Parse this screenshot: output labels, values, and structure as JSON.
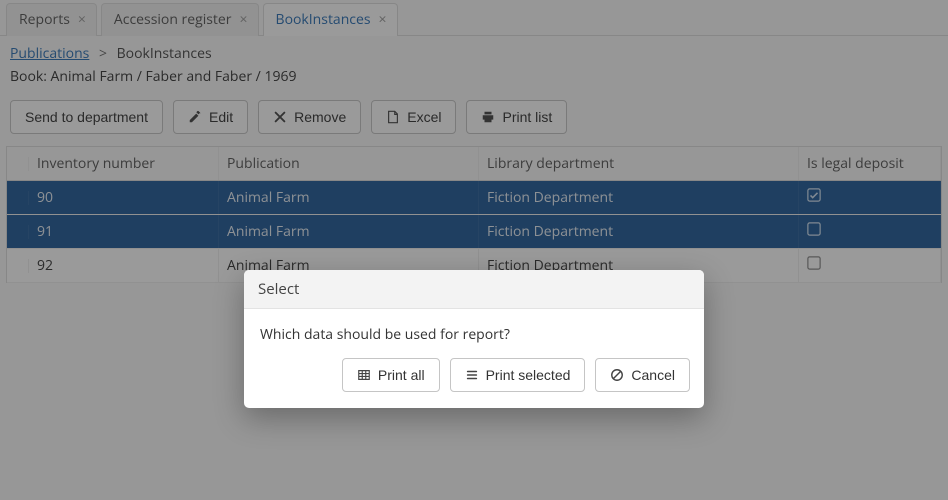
{
  "tabs": [
    {
      "label": "Reports",
      "active": false
    },
    {
      "label": "Accession register",
      "active": false
    },
    {
      "label": "BookInstances",
      "active": true
    }
  ],
  "breadcrumb": {
    "root": "Publications",
    "current": "BookInstances"
  },
  "subtitle": "Book: Animal Farm / Faber and Faber / 1969",
  "toolbar": {
    "send": "Send to department",
    "edit": "Edit",
    "remove": "Remove",
    "excel": "Excel",
    "print": "Print list"
  },
  "columns": {
    "inv": "Inventory number",
    "pub": "Publication",
    "dept": "Library department",
    "legal": "Is legal deposit"
  },
  "rows": [
    {
      "inv": "90",
      "pub": "Animal Farm",
      "dept": "Fiction Department",
      "legal": true,
      "selected": true
    },
    {
      "inv": "91",
      "pub": "Animal Farm",
      "dept": "Fiction Department",
      "legal": false,
      "selected": true
    },
    {
      "inv": "92",
      "pub": "Animal Farm",
      "dept": "Fiction Department",
      "legal": false,
      "selected": false
    }
  ],
  "modal": {
    "title": "Select",
    "question": "Which data should be used for report?",
    "print_all": "Print all",
    "print_selected": "Print selected",
    "cancel": "Cancel"
  }
}
